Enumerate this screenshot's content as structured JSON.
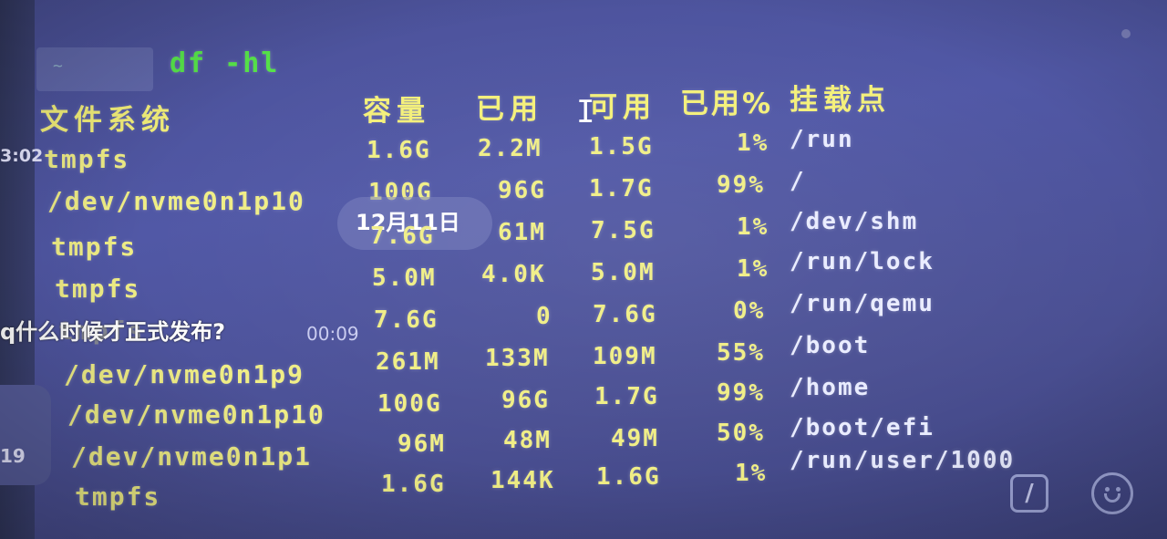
{
  "terminal": {
    "command": "df -hl",
    "prompt_symbol": "~",
    "headers": [
      "文件系统",
      "容量",
      "已用",
      "可用",
      "已用%",
      "挂载点"
    ],
    "rows": [
      {
        "fs": "tmpfs",
        "size": "1.6G",
        "used": "2.2M",
        "avail": "1.5G",
        "pct": "1%",
        "mount": "/run"
      },
      {
        "fs": "/dev/nvme0n1p10",
        "size": "100G",
        "used": "96G",
        "avail": "1.7G",
        "pct": "99%",
        "mount": "/"
      },
      {
        "fs": "tmpfs",
        "size": "7.6G",
        "used": "61M",
        "avail": "7.5G",
        "pct": "1%",
        "mount": "/dev/shm"
      },
      {
        "fs": "tmpfs",
        "size": "5.0M",
        "used": "4.0K",
        "avail": "5.0M",
        "pct": "1%",
        "mount": "/run/lock"
      },
      {
        "fs": "tmpfs",
        "size": "7.6G",
        "used": "0",
        "avail": "7.6G",
        "pct": "0%",
        "mount": "/run/qemu"
      },
      {
        "fs": "/dev/nvme0n1p9",
        "size": "261M",
        "used": "133M",
        "avail": "109M",
        "pct": "55%",
        "mount": "/boot"
      },
      {
        "fs": "/dev/nvme0n1p10",
        "size": "100G",
        "used": "96G",
        "avail": "1.7G",
        "pct": "99%",
        "mount": "/home"
      },
      {
        "fs": "/dev/nvme0n1p1",
        "size": "96M",
        "used": "48M",
        "avail": "49M",
        "pct": "50%",
        "mount": "/boot/efi"
      },
      {
        "fs": "tmpfs",
        "size": "1.6G",
        "used": "144K",
        "avail": "1.6G",
        "pct": "1%",
        "mount": "/run/user/1000"
      }
    ]
  },
  "overlay": {
    "date": "12月11日",
    "message": "q什么时候才正式发布?",
    "message_time": "00:09",
    "side_time": "3:02",
    "side_count": "19",
    "slash_button": "/"
  },
  "icons": {
    "cursor": "text-cursor-icon",
    "emoji": "emoji-icon",
    "slash": "command-slash-icon"
  }
}
